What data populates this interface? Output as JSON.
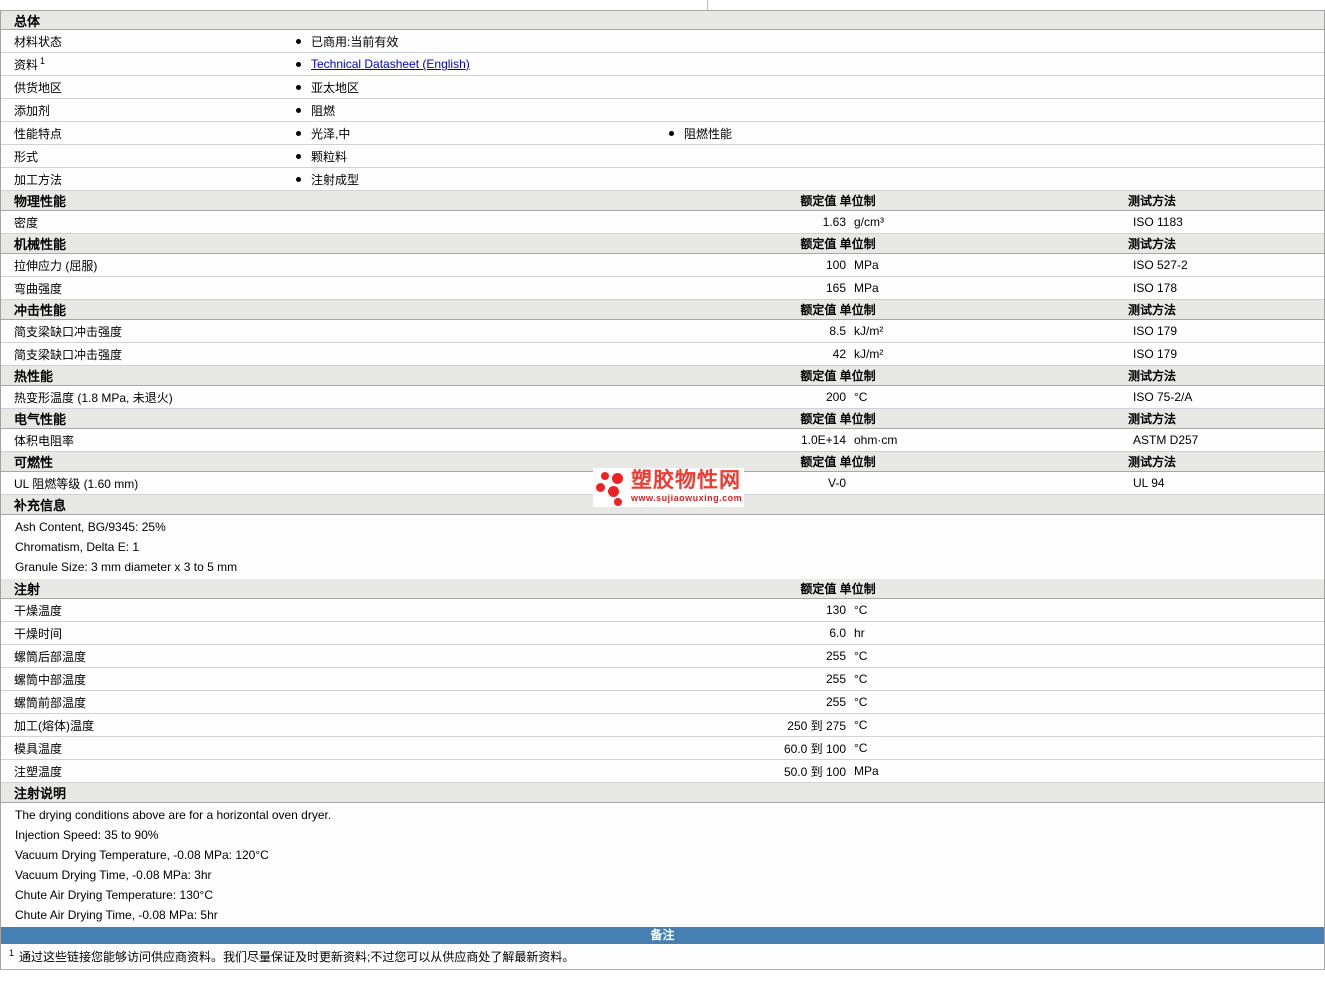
{
  "columns": {
    "value_unit": "额定值 单位制",
    "test_method": "测试方法"
  },
  "general": {
    "title": "总体",
    "rows": [
      {
        "label": "材料状态",
        "item": "已商用:当前有效"
      },
      {
        "label": "资料",
        "sup": "1",
        "link": "Technical Datasheet (English)"
      },
      {
        "label": "供货地区",
        "item": "亚太地区"
      },
      {
        "label": "添加剂",
        "item": "阻燃"
      },
      {
        "label": "性能特点",
        "item": "光泽,中",
        "item2": "阻燃性能"
      },
      {
        "label": "形式",
        "item": "颗粒料"
      },
      {
        "label": "加工方法",
        "item": "注射成型"
      }
    ]
  },
  "physical": {
    "title": "物理性能",
    "rows": [
      {
        "label": "密度",
        "value": "1.63",
        "unit": "g/cm³",
        "method": "ISO 1183"
      }
    ]
  },
  "mechanical": {
    "title": "机械性能",
    "rows": [
      {
        "label": "拉伸应力 (屈服)",
        "value": "100",
        "unit": "MPa",
        "method": "ISO 527-2"
      },
      {
        "label": "弯曲强度",
        "value": "165",
        "unit": "MPa",
        "method": "ISO 178"
      }
    ]
  },
  "impact": {
    "title": "冲击性能",
    "rows": [
      {
        "label": "简支梁缺口冲击强度",
        "value": "8.5",
        "unit": "kJ/m²",
        "method": "ISO 179"
      },
      {
        "label": "简支梁缺口冲击强度",
        "value": "42",
        "unit": "kJ/m²",
        "method": "ISO 179"
      }
    ]
  },
  "thermal": {
    "title": "热性能",
    "rows": [
      {
        "label": "热变形温度 (1.8 MPa, 未退火)",
        "value": "200",
        "unit": "°C",
        "method": "ISO 75-2/A"
      }
    ]
  },
  "electrical": {
    "title": "电气性能",
    "rows": [
      {
        "label": "体积电阻率",
        "value": "1.0E+14",
        "unit": "ohm·cm",
        "method": "ASTM D257"
      }
    ]
  },
  "flammability": {
    "title": "可燃性",
    "rows": [
      {
        "label": "UL 阻燃等级 (1.60 mm)",
        "value": "V-0",
        "unit": "",
        "method": "UL 94"
      }
    ]
  },
  "supplemental": {
    "title": "补充信息",
    "lines": [
      "Ash Content, BG/9345: 25%",
      "Chromatism, Delta E: 1",
      "Granule Size: 3 mm diameter x 3 to 5 mm"
    ]
  },
  "injection": {
    "title": "注射",
    "rows": [
      {
        "label": "干燥温度",
        "value": "130",
        "unit": "°C"
      },
      {
        "label": "干燥时间",
        "value": "6.0",
        "unit": "hr"
      },
      {
        "label": "螺筒后部温度",
        "value": "255",
        "unit": "°C"
      },
      {
        "label": "螺筒中部温度",
        "value": "255",
        "unit": "°C"
      },
      {
        "label": "螺筒前部温度",
        "value": "255",
        "unit": "°C"
      },
      {
        "label": "加工(熔体)温度",
        "value": "250 到 275",
        "unit": "°C"
      },
      {
        "label": "模具温度",
        "value": "60.0 到 100",
        "unit": "°C"
      },
      {
        "label": "注塑温度",
        "value": "50.0 到 100",
        "unit": "MPa"
      }
    ]
  },
  "injection_notes": {
    "title": "注射说明",
    "lines": [
      "The drying conditions above are for a horizontal oven dryer.",
      "Injection Speed: 35 to 90%",
      "Vacuum Drying Temperature, -0.08 MPa: 120°C",
      "Vacuum Drying Time, -0.08 MPa: 3hr",
      "Chute Air Drying Temperature: 130°C",
      "Chute Air Drying Time, -0.08 MPa: 5hr"
    ]
  },
  "notes_bar": {
    "label": "备注"
  },
  "footnote": {
    "sup": "1",
    "text": "通过这些链接您能够访问供应商资料。我们尽量保证及时更新资料;不过您可以从供应商处了解最新资料。"
  },
  "watermark": {
    "title": "塑胶物性网",
    "url": "www.sujiaowuxing.com"
  },
  "colors": {
    "notes_bar_bg": "#4680b2",
    "link": "#0000cc",
    "logo_red": "#ee2222",
    "section_header_bg": "#e8e8e4"
  }
}
